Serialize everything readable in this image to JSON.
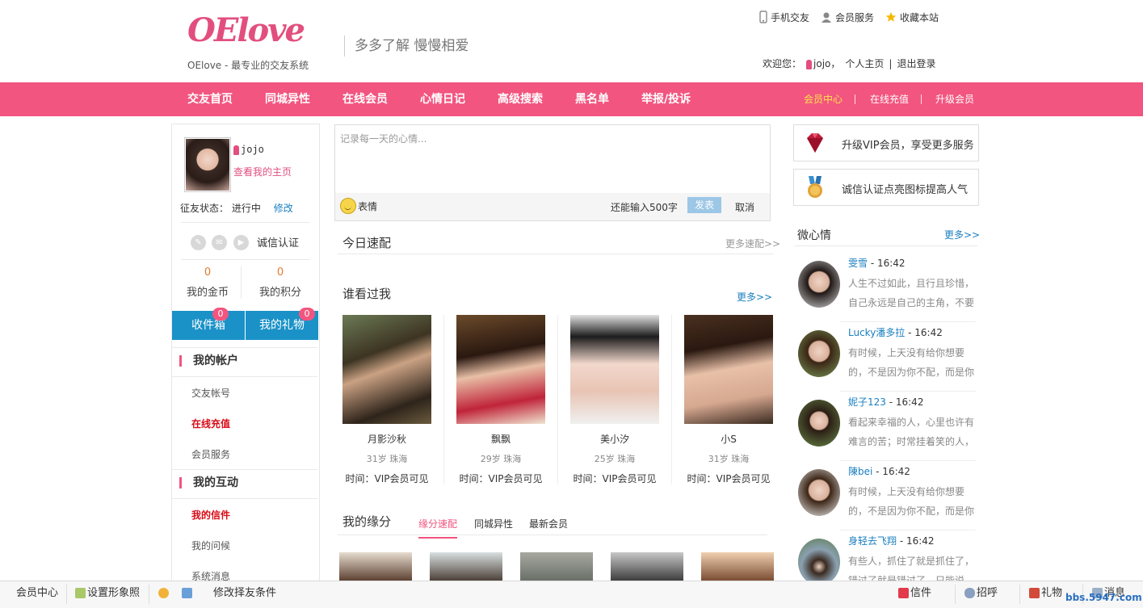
{
  "header": {
    "logo_text": "OElove",
    "logo_sub": "OElove - 最专业的交友系统",
    "slogan": "多多了解  慢慢相爱",
    "toplinks": [
      "手机交友",
      "会员服务",
      "收藏本站"
    ],
    "welcome_prefix": "欢迎您：",
    "welcome_user": "jojo，",
    "welcome_home": "个人主页",
    "welcome_sep": "|",
    "welcome_logout": "退出登录"
  },
  "nav": {
    "items": [
      "交友首页",
      "同城异性",
      "在线会员",
      "心情日记",
      "高级搜索",
      "黑名单",
      "举报/投诉"
    ],
    "right": [
      "会员中心",
      "在线充值",
      "升级会员"
    ],
    "active_color": "#ffe24a",
    "bg_color": "#f2557f"
  },
  "profile": {
    "name": "jojo",
    "view_home": "查看我的主页",
    "status_label": "征友状态：",
    "status_value": "进行中",
    "status_edit": "修改",
    "verify_label": "诚信认证",
    "gold_value": "0",
    "gold_label": "我的金币",
    "points_value": "0",
    "points_label": "我的积分",
    "inbox_label": "收件箱",
    "inbox_badge": "0",
    "gifts_label": "我的礼物",
    "gifts_badge": "0"
  },
  "menu": {
    "account_title": "我的帐户",
    "account_items": [
      "交友帐号",
      "在线充值",
      "会员服务"
    ],
    "interact_title": "我的互动",
    "interact_items": [
      "我的信件",
      "我的问候",
      "系统消息"
    ]
  },
  "post": {
    "placeholder": "记录每一天的心情...",
    "emoji_label": "表情",
    "remaining": "还能输入500字",
    "publish": "发表",
    "cancel": "取消"
  },
  "today_match": {
    "title": "今日速配",
    "more": "更多速配>>"
  },
  "who_viewed": {
    "title": "谁看过我",
    "more": "更多>>",
    "cards": [
      {
        "name": "月影沙秋",
        "meta": "31岁  珠海",
        "time": "时间：VIP会员可见"
      },
      {
        "name": "飘飘",
        "meta": "29岁  珠海",
        "time": "时间：VIP会员可见"
      },
      {
        "name": "美小汐",
        "meta": "25岁  珠海",
        "time": "时间：VIP会员可见"
      },
      {
        "name": "小S",
        "meta": "31岁  珠海",
        "time": "时间：VIP会员可见"
      }
    ]
  },
  "fate": {
    "title": "我的缘分",
    "tabs": [
      "缘分速配",
      "同城异性",
      "最新会员"
    ]
  },
  "promos": [
    "升级VIP会员，享受更多服务",
    "诚信认证点亮图标提高人气"
  ],
  "weibo": {
    "title": "微心情",
    "more": "更多>>",
    "items": [
      {
        "name": "雯雪",
        "time": " - 16:42",
        "text": "人生不过如此，且行且珍惜，自己永远是自己的主角，不要"
      },
      {
        "name": "Lucky潘多拉",
        "time": " - 16:42",
        "text": "有时候，上天没有给你想要的，不是因为你不配，而是你"
      },
      {
        "name": "妮子123",
        "time": " - 16:42",
        "text": "看起来幸福的人，心里也许有难言的苦；时常挂着笑的人，"
      },
      {
        "name": "陳bei",
        "time": " - 16:42",
        "text": "有时候，上天没有给你想要的，不是因为你不配，而是你"
      },
      {
        "name": "身轻去飞翔",
        "time": " - 16:42",
        "text": "有些人，抓住了就是抓住了，错过了就是错过了，只能说"
      }
    ]
  },
  "footer": {
    "member_center": "会员中心",
    "set_photo": "设置形象照",
    "edit_conditions": "修改择友条件",
    "mail": "信件",
    "greet": "招呼",
    "gift": "礼物",
    "messages": "消息"
  },
  "watermark": "bbs.5947.com"
}
